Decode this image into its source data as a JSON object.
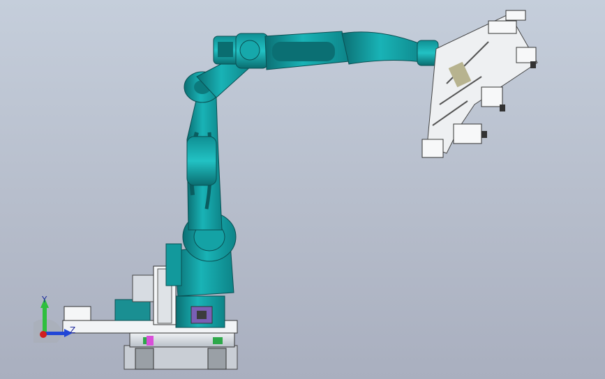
{
  "view": {
    "background_top": "#c5cedb",
    "background_bottom": "#a9afbf",
    "model_colors": {
      "robot_teal": "#19b3b6",
      "robot_dark": "#0b6f73",
      "gripper": "#f1f3f5",
      "base_steel": "#d8dde3",
      "accent_magenta": "#d94fd9",
      "accent_purple": "#7a5fb5"
    }
  },
  "triad": {
    "y_label": "Y",
    "z_label": "Z",
    "y_color": "#2fbf3d",
    "z_color": "#2146d6",
    "x_color": "#d11f1f"
  }
}
